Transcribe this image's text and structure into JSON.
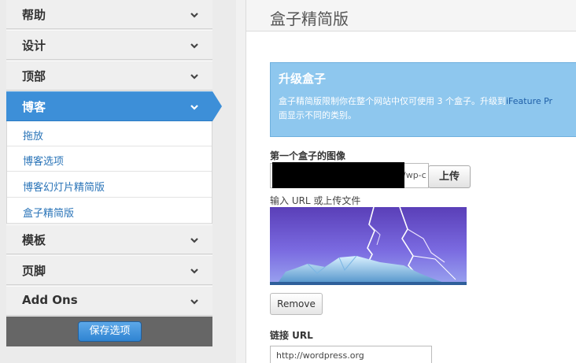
{
  "sidebar": {
    "menu_top": [
      {
        "label": "帮助"
      },
      {
        "label": "设计"
      },
      {
        "label": "顶部"
      },
      {
        "label": "博客"
      }
    ],
    "submenu": [
      {
        "label": "拖放"
      },
      {
        "label": "博客选项"
      },
      {
        "label": "博客幻灯片精简版"
      },
      {
        "label": "盒子精简版"
      }
    ],
    "menu_bottom": [
      {
        "label": "模板"
      },
      {
        "label": "页脚"
      },
      {
        "label": "Add Ons"
      }
    ],
    "save_label": "保存选项"
  },
  "main": {
    "title": "盒子精简版",
    "notice": {
      "title": "升级盒子",
      "line1": "盒子精简版限制你在整个网站中仅可使用 3 个盒子。升级到",
      "link": "iFeature Pr",
      "line2": "面显示不同的类别。"
    },
    "image_field": {
      "label": "第一个盒子的图像",
      "value_fragment": "/wp-c",
      "upload_label": "上传",
      "hint": "输入 URL 或上传文件",
      "remove_label": "Remove"
    },
    "link_field": {
      "label": "链接 URL",
      "value": "http://wordpress.org"
    }
  }
}
